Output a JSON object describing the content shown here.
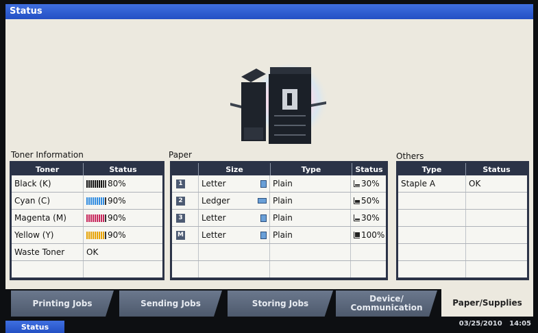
{
  "title": "Status",
  "sections": {
    "toner_title": "Toner Information",
    "paper_title": "Paper",
    "others_title": "Others"
  },
  "toner": {
    "headers": [
      "Toner",
      "Status"
    ],
    "rows": [
      {
        "name": "Black (K)",
        "pct": "80%",
        "level": 0.8,
        "color": "#111111"
      },
      {
        "name": "Cyan (C)",
        "pct": "90%",
        "level": 0.9,
        "color": "#2f8be0"
      },
      {
        "name": "Magenta (M)",
        "pct": "90%",
        "level": 0.9,
        "color": "#c6245a"
      },
      {
        "name": "Yellow (Y)",
        "pct": "90%",
        "level": 0.9,
        "color": "#e6a100"
      },
      {
        "name": "Waste Toner",
        "status": "OK"
      }
    ]
  },
  "paper": {
    "headers": [
      "",
      "Size",
      "Type",
      "Status"
    ],
    "rows": [
      {
        "tray": "1",
        "size": "Letter",
        "type": "Plain",
        "status": "30%",
        "orientation": "portrait",
        "level": "30"
      },
      {
        "tray": "2",
        "size": "Ledger",
        "type": "Plain",
        "status": "50%",
        "orientation": "landscape",
        "level": "50"
      },
      {
        "tray": "3",
        "size": "Letter",
        "type": "Plain",
        "status": "30%",
        "orientation": "portrait",
        "level": "30"
      },
      {
        "tray": "M",
        "size": "Letter",
        "type": "Plain",
        "status": "100%",
        "orientation": "portrait",
        "level": "100"
      }
    ]
  },
  "others": {
    "headers": [
      "Type",
      "Status"
    ],
    "rows": [
      {
        "type": "Staple A",
        "status": "OK"
      }
    ]
  },
  "tabs": [
    {
      "label": "Printing Jobs"
    },
    {
      "label": "Sending Jobs"
    },
    {
      "label": "Storing Jobs"
    },
    {
      "label": "Device/\nCommunication"
    },
    {
      "label": "Paper/Supplies",
      "active": true
    }
  ],
  "footer": {
    "status_label": "Status",
    "date": "03/25/2010",
    "time": "14:05"
  },
  "colors": {
    "accent": "#2f5fd6",
    "panel": "#2b3347",
    "background": "#ece9df"
  },
  "icons": [
    "printer-illustration",
    "tray-1-icon",
    "tray-2-icon",
    "tray-3-icon",
    "tray-m-icon",
    "paper-portrait-icon",
    "paper-landscape-icon",
    "paper-level-icon"
  ]
}
